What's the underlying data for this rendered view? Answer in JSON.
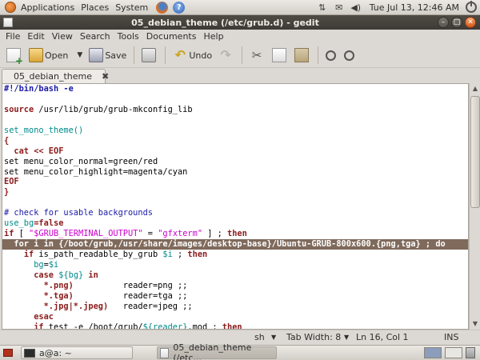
{
  "top_panel": {
    "menus": [
      "Applications",
      "Places",
      "System"
    ],
    "clock": "Tue Jul 13, 12:46 AM",
    "help_glyph": "?"
  },
  "window": {
    "title": "05_debian_theme (/etc/grub.d) - gedit"
  },
  "menubar": [
    "File",
    "Edit",
    "View",
    "Search",
    "Tools",
    "Documents",
    "Help"
  ],
  "toolbar": {
    "open_label": "Open",
    "save_label": "Save",
    "undo_label": "Undo"
  },
  "tab": {
    "label": "05_debian_theme",
    "close_glyph": "✖"
  },
  "code": {
    "current_line_index": 15,
    "lines": [
      [
        {
          "t": "#!/bin/bash -e",
          "c": "#1a1aa6",
          "b": true
        }
      ],
      [
        {
          "t": "",
          "c": "#000000"
        }
      ],
      [
        {
          "t": "source",
          "c": "#8b1a1a",
          "b": true
        },
        {
          "t": " /usr/lib/grub/grub-mkconfig_lib",
          "c": "#000000"
        }
      ],
      [
        {
          "t": "",
          "c": "#000000"
        }
      ],
      [
        {
          "t": "set_mono_theme()",
          "c": "#008b8b"
        }
      ],
      [
        {
          "t": "{",
          "c": "#8b1a1a",
          "b": true
        }
      ],
      [
        {
          "t": "  cat << EOF",
          "c": "#8b1a1a",
          "b": true
        }
      ],
      [
        {
          "t": "set menu_color_normal=green/red",
          "c": "#000000"
        }
      ],
      [
        {
          "t": "set menu_color_highlight=magenta/cyan",
          "c": "#000000"
        }
      ],
      [
        {
          "t": "EOF",
          "c": "#8b1a1a",
          "b": true
        }
      ],
      [
        {
          "t": "}",
          "c": "#8b1a1a",
          "b": true
        }
      ],
      [
        {
          "t": "",
          "c": "#000000"
        }
      ],
      [
        {
          "t": "# check for usable backgrounds",
          "c": "#1a1aa6"
        }
      ],
      [
        {
          "t": "use_bg",
          "c": "#008b8b"
        },
        {
          "t": "=false",
          "c": "#8b1a1a",
          "b": true
        }
      ],
      [
        {
          "t": "if",
          "c": "#8b1a1a",
          "b": true
        },
        {
          "t": " [ ",
          "c": "#000000"
        },
        {
          "t": "\"$GRUB_TERMINAL_OUTPUT\"",
          "c": "#cc00cc"
        },
        {
          "t": " = ",
          "c": "#000000"
        },
        {
          "t": "\"gfxterm\"",
          "c": "#cc00cc"
        },
        {
          "t": " ] ; ",
          "c": "#000000"
        },
        {
          "t": "then",
          "c": "#8b1a1a",
          "b": true
        }
      ],
      [
        {
          "t": "  for i in {/boot/grub,/usr/share/images/desktop-base}/Ubuntu-GRUB-800x600.{png,tga} ; do",
          "c": "#ffffff",
          "b": true
        }
      ],
      [
        {
          "t": "    ",
          "c": "#000000"
        },
        {
          "t": "if",
          "c": "#8b1a1a",
          "b": true
        },
        {
          "t": " is_path_readable_by_grub ",
          "c": "#000000"
        },
        {
          "t": "$i",
          "c": "#008b8b"
        },
        {
          "t": " ; ",
          "c": "#000000"
        },
        {
          "t": "then",
          "c": "#8b1a1a",
          "b": true
        }
      ],
      [
        {
          "t": "      ",
          "c": "#000000"
        },
        {
          "t": "bg",
          "c": "#008b8b"
        },
        {
          "t": "=",
          "c": "#000000"
        },
        {
          "t": "$i",
          "c": "#008b8b"
        }
      ],
      [
        {
          "t": "      ",
          "c": "#000000"
        },
        {
          "t": "case",
          "c": "#8b1a1a",
          "b": true
        },
        {
          "t": " ",
          "c": "#000000"
        },
        {
          "t": "${bg}",
          "c": "#008b8b"
        },
        {
          "t": " in",
          "c": "#8b1a1a",
          "b": true
        }
      ],
      [
        {
          "t": "        *.png)",
          "c": "#8b1a1a",
          "b": true
        },
        {
          "t": "          reader=png ;;",
          "c": "#000000"
        }
      ],
      [
        {
          "t": "        *.tga)",
          "c": "#8b1a1a",
          "b": true
        },
        {
          "t": "          reader=tga ;;",
          "c": "#000000"
        }
      ],
      [
        {
          "t": "        *.jpg|*.jpeg)",
          "c": "#8b1a1a",
          "b": true
        },
        {
          "t": "   reader=jpeg ;;",
          "c": "#000000"
        }
      ],
      [
        {
          "t": "      esac",
          "c": "#8b1a1a",
          "b": true
        }
      ],
      [
        {
          "t": "      ",
          "c": "#000000"
        },
        {
          "t": "if",
          "c": "#8b1a1a",
          "b": true
        },
        {
          "t": " test -e /boot/grub/",
          "c": "#000000"
        },
        {
          "t": "${reader}",
          "c": "#008b8b"
        },
        {
          "t": ".mod ; ",
          "c": "#000000"
        },
        {
          "t": "then",
          "c": "#8b1a1a",
          "b": true
        }
      ]
    ]
  },
  "statusbar": {
    "language": "sh",
    "tab_width": "Tab Width:  8",
    "position": "Ln 16, Col 1",
    "mode": "INS"
  },
  "bottom_panel": {
    "tasks": [
      "a@a: ~",
      "05_debian_theme (/etc..."
    ]
  }
}
